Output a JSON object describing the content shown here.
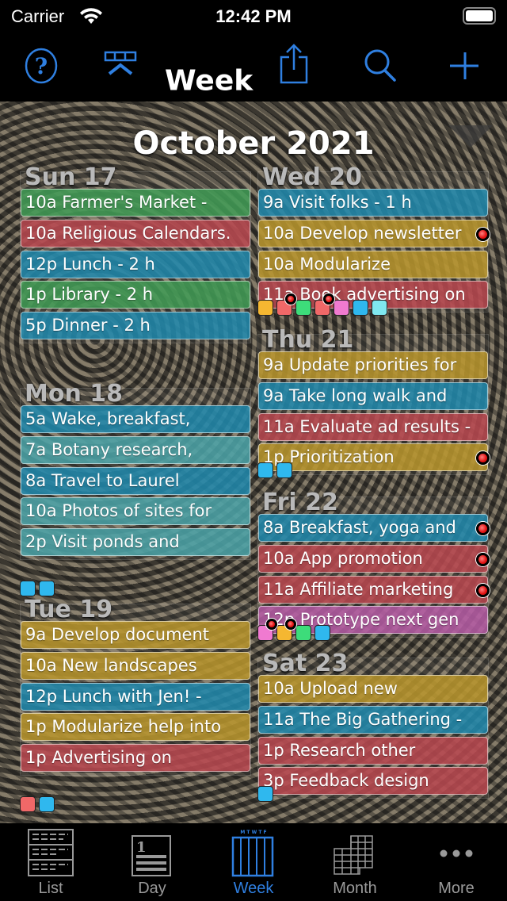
{
  "status": {
    "carrier": "Carrier",
    "time": "12:42 PM"
  },
  "nav": {
    "title": "Week",
    "icons": [
      "help-icon",
      "week-selector-icon",
      "share-icon",
      "search-icon",
      "add-icon"
    ],
    "accent": "#2f7fe0"
  },
  "month": "October 2021",
  "colors": {
    "green": "#3f9b55",
    "red": "#b8474f",
    "blue": "#1f88ad",
    "teal": "#4aa3a8",
    "yellow": "#b8952b",
    "pink": "#b55aa5"
  },
  "days": [
    {
      "label": "Sun 17",
      "events": [
        {
          "t": "10a  Farmer's Market -",
          "c": "green"
        },
        {
          "t": "10a  Religious Calendars.",
          "c": "red"
        },
        {
          "t": "12p  Lunch - 2 h",
          "c": "blue"
        },
        {
          "t": "1p  Library - 2 h",
          "c": "green"
        },
        {
          "t": "5p  Dinner - 2 h",
          "c": "blue"
        }
      ],
      "more": []
    },
    {
      "label": "Mon 18",
      "events": [
        {
          "t": "5a  Wake, breakfast,",
          "c": "blue"
        },
        {
          "t": "7a  Botany research,",
          "c": "teal"
        },
        {
          "t": "8a  Travel to Laurel",
          "c": "blue"
        },
        {
          "t": "10a  Photos of sites for",
          "c": "teal"
        },
        {
          "t": "2p  Visit ponds and",
          "c": "teal"
        }
      ],
      "more": [
        "#2fb8ee",
        "#2fb8ee"
      ]
    },
    {
      "label": "Tue 19",
      "events": [
        {
          "t": "9a  Develop document",
          "c": "yellow"
        },
        {
          "t": "10a  New landscapes",
          "c": "yellow"
        },
        {
          "t": "12p  Lunch with Jen! -",
          "c": "blue"
        },
        {
          "t": "1p  Modularize help into",
          "c": "yellow"
        },
        {
          "t": "1p  Advertising on",
          "c": "red"
        }
      ],
      "more": [
        "#f06868",
        "#2fb8ee"
      ]
    },
    {
      "label": "Wed 20",
      "events": [
        {
          "t": "9a  Visit folks - 1 h",
          "c": "blue"
        },
        {
          "t": "10a  Develop newsletter",
          "c": "yellow",
          "alarm": true
        },
        {
          "t": "10a  Modularize",
          "c": "yellow"
        },
        {
          "t": "11a  Book advertising on",
          "c": "red"
        }
      ],
      "more": [
        "#f5b731",
        "#f06868",
        "#3ddc7a",
        "#f06868",
        "#f07ad0",
        "#2fb8ee",
        "#7fe8f0"
      ],
      "moreAlarms": [
        1,
        3
      ]
    },
    {
      "label": "Thu 21",
      "events": [
        {
          "t": "9a  Update priorities for",
          "c": "yellow"
        },
        {
          "t": "9a  Take long walk and",
          "c": "blue"
        },
        {
          "t": "11a  Evaluate ad results -",
          "c": "red"
        },
        {
          "t": "1p  Prioritization",
          "c": "yellow",
          "alarm": true
        }
      ],
      "more": [
        "#2fb8ee",
        "#2fb8ee"
      ]
    },
    {
      "label": "Fri 22",
      "events": [
        {
          "t": "8a  Breakfast, yoga and",
          "c": "blue",
          "alarm": true
        },
        {
          "t": "10a  App promotion",
          "c": "red",
          "alarm": true
        },
        {
          "t": "11a  Affiliate marketing",
          "c": "red",
          "alarm": true
        },
        {
          "t": "12p  Prototype next gen",
          "c": "pink"
        }
      ],
      "more": [
        "#f07ad0",
        "#f5b731",
        "#3ddc7a",
        "#2fb8ee"
      ],
      "moreAlarms": [
        0,
        1
      ]
    },
    {
      "label": "Sat 23",
      "events": [
        {
          "t": "10a  Upload new",
          "c": "yellow"
        },
        {
          "t": "11a  The Big Gathering -",
          "c": "blue"
        },
        {
          "t": "1p  Research other",
          "c": "red"
        },
        {
          "t": "3p  Feedback design",
          "c": "red"
        }
      ],
      "more": [
        "#2fb8ee"
      ]
    }
  ],
  "tabs": [
    {
      "label": "List"
    },
    {
      "label": "Day"
    },
    {
      "label": "Week",
      "selected": true,
      "week_letters": "M T W T F"
    },
    {
      "label": "Month"
    },
    {
      "label": "More"
    }
  ]
}
